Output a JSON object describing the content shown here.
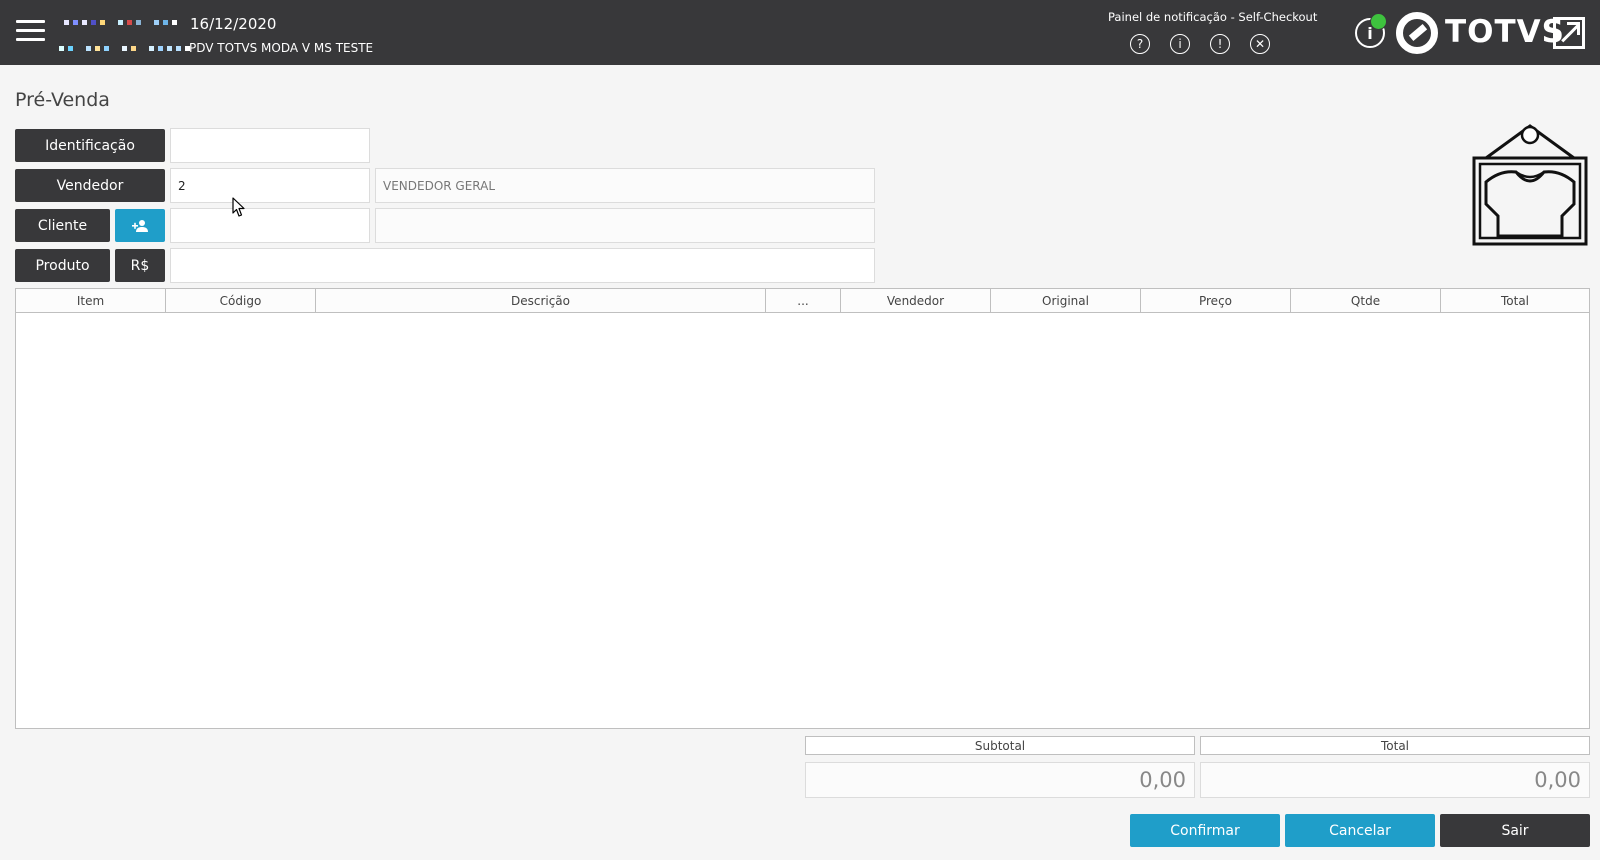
{
  "header": {
    "date": "16/12/2020",
    "store": "PDV TOTVS MODA V MS TESTE",
    "notification_title": "Painel de notificação - Self-Checkout",
    "notification_icons": [
      "?",
      "i",
      "!",
      "✕"
    ],
    "brand": "TOTVS",
    "colors": {
      "background": "#38383a",
      "status_online": "#3ec23e"
    }
  },
  "page": {
    "title": "Pré-Venda"
  },
  "form": {
    "identificacao_label": "Identificação",
    "identificacao_value": "",
    "vendedor_label": "Vendedor",
    "vendedor_code": "2",
    "vendedor_name": "VENDEDOR GERAL",
    "cliente_label": "Cliente",
    "cliente_code": "",
    "cliente_name": "",
    "produto_label": "Produto",
    "preco_label": "R$",
    "produto_value": ""
  },
  "grid": {
    "columns": [
      "Item",
      "Código",
      "Descrição",
      "...",
      "Vendedor",
      "Original",
      "Preço",
      "Qtde",
      "Total"
    ],
    "rows": []
  },
  "totals": {
    "subtotal_label": "Subtotal",
    "subtotal_value": "0,00",
    "total_label": "Total",
    "total_value": "0,00"
  },
  "actions": {
    "confirm": "Confirmar",
    "cancel": "Cancelar",
    "exit": "Sair",
    "colors": {
      "primary": "#1f9ec9",
      "dark": "#38383a"
    }
  }
}
